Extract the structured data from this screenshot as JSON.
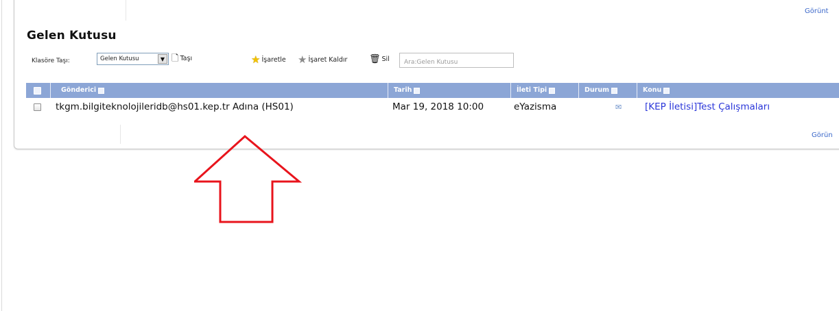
{
  "header": {
    "right_link": "Görünt",
    "title": "Gelen Kutusu"
  },
  "toolbar": {
    "move_label": "Klasöre Taşı:",
    "folder_select_value": "Gelen Kutusu",
    "move_button": "Taşı",
    "mark_button": "İşaretle",
    "unmark_button": "İşaret Kaldır",
    "delete_button": "Sil",
    "search_placeholder": "Ara:Gelen Kutusu"
  },
  "table": {
    "columns": {
      "sender": "Gönderici",
      "date": "Tarih",
      "type": "İleti Tipi",
      "status": "Durum",
      "subject": "Konu"
    },
    "rows": [
      {
        "sender": "tkgm.bilgiteknolojileridb@hs01.kep.tr Adına (HS01)",
        "date": "Mar 19, 2018 10:00",
        "type": "eYazisma",
        "status_icon": "envelope-icon",
        "subject": "[KEP İletisi]Test Çalışmaları"
      }
    ]
  },
  "footer": {
    "right_link": "Görün"
  },
  "colors": {
    "header_bar": "#8ca6d6",
    "link": "#2a36d9",
    "annotation_arrow": "#e8141c"
  }
}
